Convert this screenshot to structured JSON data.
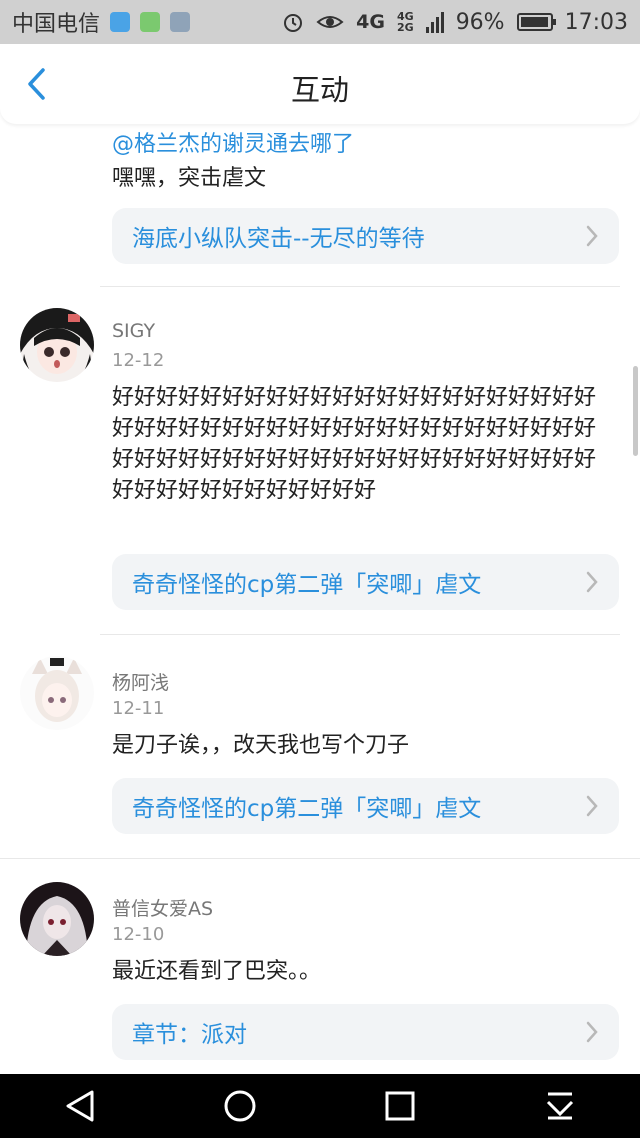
{
  "status_bar": {
    "carrier": "中国电信",
    "network_top": "4G",
    "network_bottom": "2G",
    "network_main": "4G",
    "battery": "96%",
    "battery_level": 0.96,
    "time": "17:03"
  },
  "header": {
    "title": "互动",
    "back_icon": "chevron-left-icon"
  },
  "comments": [
    {
      "username": "",
      "date": "",
      "mention": "@格兰杰的谢灵通去哪了",
      "text": "嘿嘿，突击虐文",
      "link": "海底小纵队突击--无尽的等待"
    },
    {
      "username": "SIGY",
      "date": "12-12",
      "text": "好好好好好好好好好好好好好好好好好好好好好好好好好好好好好好好好好好好好好好好好好好好好好好好好好好好好好好好好好好好好好好好好好好好好好好好好好好好好好好",
      "link": "奇奇怪怪的cp第二弹「突唧」虐文"
    },
    {
      "username": "杨阿浅",
      "date": "12-11",
      "text": "是刀子诶，，改天我也写个刀子",
      "link": "奇奇怪怪的cp第二弹「突唧」虐文"
    },
    {
      "username": "普信女爱AS",
      "date": "12-10",
      "text": "最近还看到了巴突。。",
      "link": "章节：派对"
    }
  ],
  "colors": {
    "accent": "#2a8fdc",
    "card_bg": "#f2f4f6",
    "status_bar_bg": "#d0d0d0",
    "nav_bar_bg": "#000000"
  }
}
